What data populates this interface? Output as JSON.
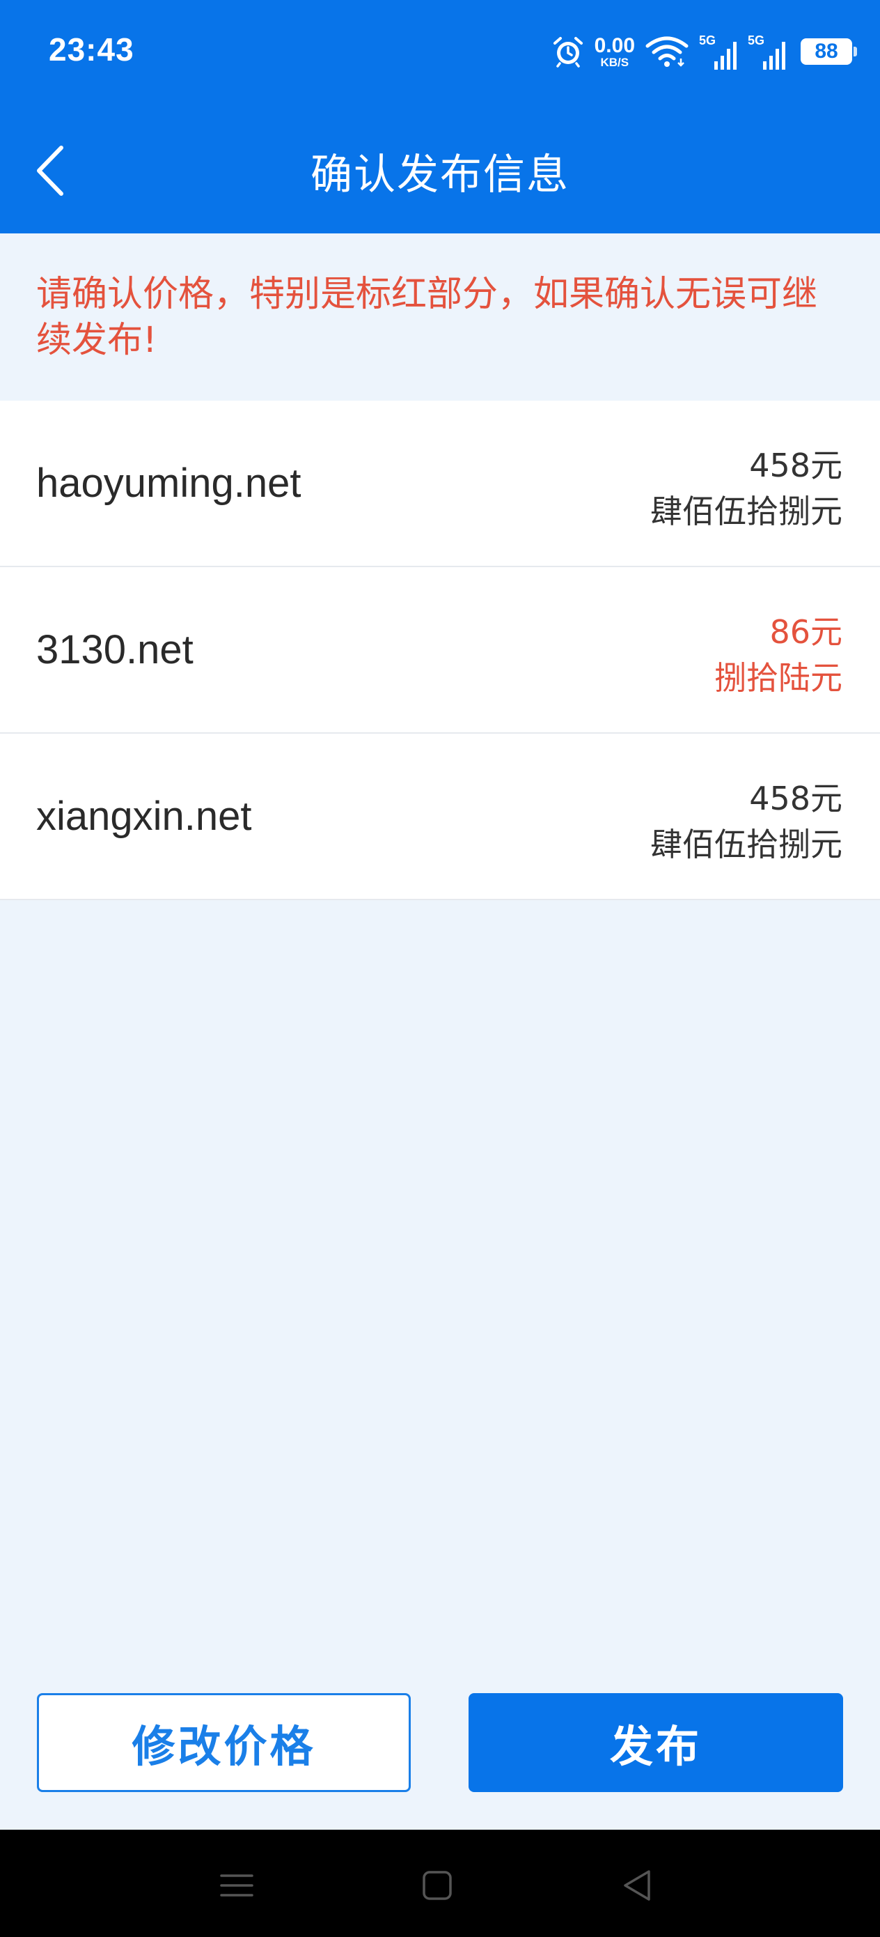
{
  "status_bar": {
    "time": "23:43",
    "net_speed_value": "0.00",
    "net_speed_unit": "KB/S",
    "signal1_tag": "5G",
    "signal2_tag": "5G",
    "battery": "88",
    "icons": [
      "alarm-icon",
      "wifi-icon",
      "signal-icon",
      "signal-icon",
      "battery-icon"
    ]
  },
  "header": {
    "title": "确认发布信息",
    "back_icon": "chevron-left-icon"
  },
  "notice": {
    "text": "请确认价格，特别是标红部分，如果确认无误可继续发布!"
  },
  "items": [
    {
      "domain": "haoyuming.net",
      "price": "458元",
      "price_cn": "肆佰伍拾捌元",
      "highlight": false
    },
    {
      "domain": "3130.net",
      "price": "86元",
      "price_cn": "捌拾陆元",
      "highlight": true
    },
    {
      "domain": "xiangxin.net",
      "price": "458元",
      "price_cn": "肆佰伍拾捌元",
      "highlight": false
    }
  ],
  "buttons": {
    "modify_label": "修改价格",
    "publish_label": "发布"
  },
  "colors": {
    "primary": "#0874E9",
    "warning_red": "#E4523D",
    "page_bg": "#EDF4FC"
  }
}
